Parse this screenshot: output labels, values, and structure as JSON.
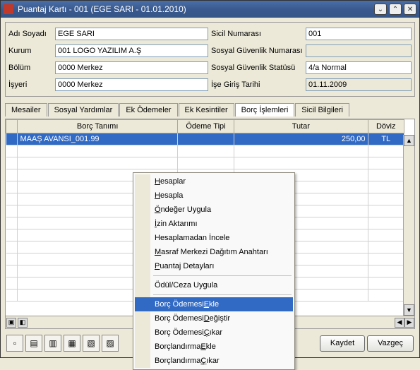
{
  "window": {
    "title": "Puantaj Kartı - 001 (EGE SARI - 01.01.2010)"
  },
  "form": {
    "left": {
      "ad_soyadi_label": "Adı Soyadı",
      "ad_soyadi_value": "EGE SARI",
      "kurum_label": "Kurum",
      "kurum_value": "001 LOGO YAZILIM A.Ş",
      "bolum_label": "Bölüm",
      "bolum_value": "0000 Merkez",
      "isyeri_label": "İşyeri",
      "isyeri_value": "0000 Merkez"
    },
    "right": {
      "sicil_label": "Sicil Numarası",
      "sicil_value": "001",
      "sgk_no_label": "Sosyal Güvenlik Numarası",
      "sgk_no_value": "",
      "sgk_statu_label": "Sosyal Güvenlik Statüsü",
      "sgk_statu_value": "4/a Normal",
      "ise_giris_label": "İşe Giriş Tarihi",
      "ise_giris_value": "01.11.2009"
    }
  },
  "tabs": {
    "mesailer": "Mesailer",
    "sosyal": "Sosyal Yardımlar",
    "ekodeme": "Ek Ödemeler",
    "ekkesinti": "Ek Kesintiler",
    "borc": "Borç İşlemleri",
    "sicil": "Sicil Bilgileri"
  },
  "grid": {
    "cols": {
      "tanim": "Borç Tanımı",
      "odeme": "Ödeme Tipi",
      "tutar": "Tutar",
      "doviz": "Döviz"
    },
    "rows": [
      {
        "tanim": "MAAŞ AVANSI_001.99",
        "odeme": "",
        "tutar": "250,00",
        "doviz": "TL"
      }
    ]
  },
  "chart_data": {
    "type": "table",
    "columns": [
      "Borç Tanımı",
      "Ödeme Tipi",
      "Tutar",
      "Döviz"
    ],
    "rows": [
      [
        "MAAŞ AVANSI_001.99",
        "",
        250.0,
        "TL"
      ]
    ]
  },
  "context_menu": {
    "items": [
      "Hesaplar",
      "Hesapla",
      "Öndeğer Uygula",
      "İzin Aktarımı",
      "Hesaplamadan İncele",
      "Masraf Merkezi Dağıtım Anahtarı",
      "Puantaj Detayları",
      "Ödül/Ceza Uygula",
      "Borç Ödemesi Ekle",
      "Borç Ödemesi Değiştir",
      "Borç Ödemesi Çıkar",
      "Borçlandırma Ekle",
      "Borçlandırma Çıkar"
    ],
    "underline_index": [
      0,
      0,
      0,
      0,
      null,
      0,
      0,
      null,
      13,
      13,
      13,
      13,
      13
    ],
    "hover_idx": 8
  },
  "buttons": {
    "kaydet": "Kaydet",
    "vazgec": "Vazgeç"
  }
}
